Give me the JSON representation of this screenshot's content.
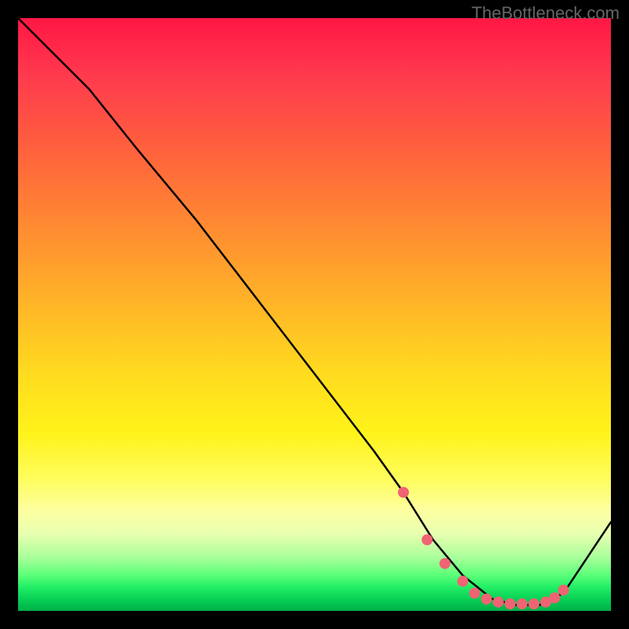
{
  "watermark": "TheBottleneck.com",
  "chart_data": {
    "type": "line",
    "title": "",
    "xlabel": "",
    "ylabel": "",
    "xlim": [
      0,
      100
    ],
    "ylim": [
      0,
      100
    ],
    "grid": false,
    "series": [
      {
        "name": "bottleneck-curve",
        "x": [
          0,
          6,
          12,
          20,
          30,
          40,
          50,
          60,
          65,
          70,
          75,
          80,
          84,
          88,
          92,
          100
        ],
        "y": [
          100,
          94,
          88,
          78,
          66,
          53,
          40,
          27,
          20,
          12,
          6,
          2,
          1,
          1,
          3,
          15
        ]
      }
    ],
    "markers": {
      "name": "optimal-range",
      "color": "#f06374",
      "x": [
        65,
        69,
        72,
        75,
        77,
        79,
        81,
        83,
        85,
        87,
        89,
        90.5,
        92
      ],
      "y": [
        20,
        12,
        8,
        5,
        3,
        2,
        1.5,
        1.2,
        1.2,
        1.2,
        1.5,
        2.2,
        3.5
      ]
    },
    "gradient_stops": [
      {
        "pos": 0,
        "color": "#ff1744"
      },
      {
        "pos": 50,
        "color": "#ffdb1f"
      },
      {
        "pos": 85,
        "color": "#fdffa0"
      },
      {
        "pos": 100,
        "color": "#00b048"
      }
    ]
  }
}
